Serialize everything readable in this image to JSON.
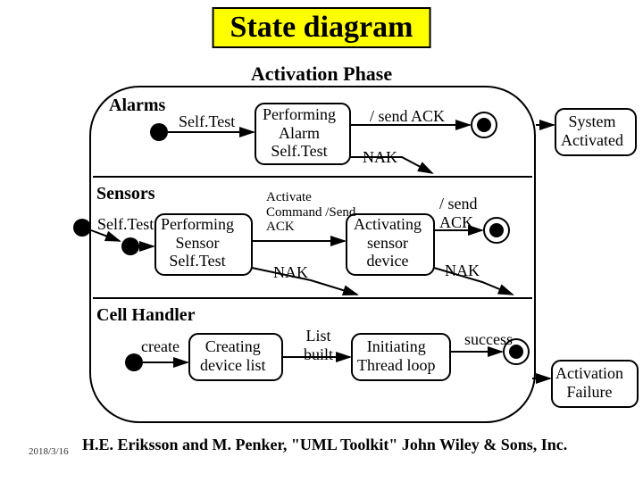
{
  "title": "State diagram",
  "phase": "Activation Phase",
  "sections": {
    "alarms": "Alarms",
    "sensors": "Sensors",
    "cellHandler": "Cell Handler"
  },
  "alarms": {
    "selfTest": "Self.Test",
    "performing": "Performing\nAlarm\nSelf.Test",
    "sendAck": "/ send ACK",
    "nak": "NAK"
  },
  "sensors": {
    "selfTest": "Self.Test",
    "performing": "Performing\nSensor\nSelf.Test",
    "activateCmd": "Activate\nCommand /Send\nACK",
    "activating": "Activating\nsensor\ndevice",
    "nak1": "NAK",
    "sendAck": "/ send\nACK",
    "nak2": "NAK"
  },
  "cell": {
    "create": "create",
    "creating": "Creating\ndevice list",
    "listBuilt": "List\nbuilt",
    "initiating": "Initiating\nThread loop",
    "success": "success"
  },
  "terminals": {
    "systemActivated": "System\nActivated",
    "activationFailure": "Activation\nFailure"
  },
  "citation": "H.E. Eriksson and M. Penker, \"UML Toolkit\" John Wiley & Sons, Inc.",
  "date": "2018/3/16"
}
